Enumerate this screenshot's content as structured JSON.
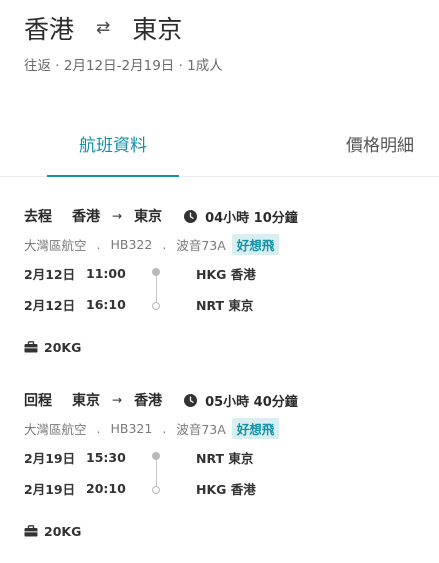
{
  "header": {
    "origin": "香港",
    "swap_icon": "⇄",
    "destination": "東京",
    "subtitle": "往返 · 2月12日-2月19日 · 1成人"
  },
  "tabs": [
    {
      "label": "航班資料",
      "active": true
    },
    {
      "label": "價格明細",
      "active": false
    }
  ],
  "legs": [
    {
      "direction": "去程",
      "from": "香港",
      "arrow": "→",
      "to": "東京",
      "duration": "04小時 10分鐘",
      "airline": "大灣區航空",
      "flight_no": "HB322",
      "aircraft": "波音73A",
      "badge": "好想飛",
      "segments": [
        {
          "date": "2月12日",
          "time": "11:00",
          "airport": "HKG 香港"
        },
        {
          "date": "2月12日",
          "time": "16:10",
          "airport": "NRT 東京"
        }
      ],
      "baggage": "20KG"
    },
    {
      "direction": "回程",
      "from": "東京",
      "arrow": "→",
      "to": "香港",
      "duration": "05小時 40分鐘",
      "airline": "大灣區航空",
      "flight_no": "HB321",
      "aircraft": "波音73A",
      "badge": "好想飛",
      "segments": [
        {
          "date": "2月19日",
          "time": "15:30",
          "airport": "NRT 東京"
        },
        {
          "date": "2月19日",
          "time": "20:10",
          "airport": "HKG 香港"
        }
      ],
      "baggage": "20KG"
    }
  ],
  "colors": {
    "accent": "#1390a3",
    "badge_bg": "#d8eef1"
  },
  "icons": {
    "duration": "clock-icon",
    "baggage": "suitcase-icon",
    "swap": "swap-icon"
  }
}
